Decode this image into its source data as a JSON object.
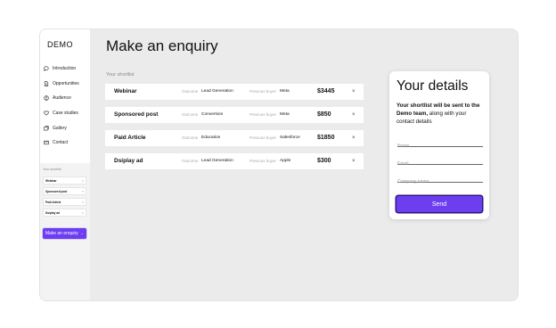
{
  "sidebar": {
    "logo": "DEMO",
    "items": [
      {
        "label": "Introduction",
        "icon": "chat-icon"
      },
      {
        "label": "Opportunities",
        "icon": "document-icon"
      },
      {
        "label": "Audience",
        "icon": "user-icon"
      },
      {
        "label": "Case studies",
        "icon": "heart-icon"
      },
      {
        "label": "Gallery",
        "icon": "gallery-icon"
      },
      {
        "label": "Contact",
        "icon": "mail-icon"
      }
    ],
    "shortlist": {
      "title": "Your shortlist",
      "items": [
        "Webinar",
        "Sponsored post",
        "Paid Article",
        "Dsiplay ad"
      ],
      "remove": "×"
    },
    "cta": "Make an enquiry →"
  },
  "main": {
    "title": "Make an enquiry",
    "shortlist_label": "Your shortlist",
    "outcome_label": "Outcome",
    "buyer_label": "Previous buyer",
    "remove": "×",
    "rows": [
      {
        "name": "Webinar",
        "outcome": "Lead Generation",
        "buyer": "Meta",
        "price": "$3445"
      },
      {
        "name": "Sponsored post",
        "outcome": "Conversion",
        "buyer": "Meta",
        "price": "$850"
      },
      {
        "name": "Paid Article",
        "outcome": "Education",
        "buyer": "Salesforce",
        "price": "$1850"
      },
      {
        "name": "Dsiplay ad",
        "outcome": "Lead Generation",
        "buyer": "Apple",
        "price": "$300"
      }
    ]
  },
  "details": {
    "title": "Your details",
    "desc_bold": "Your shortlist will be sent to the Demo team,",
    "desc_rest": " along with your contact details",
    "name_placeholder": "Name",
    "email_placeholder": "Email",
    "company_placeholder": "Company name",
    "send": "Send"
  },
  "colors": {
    "accent": "#6c3ef0"
  }
}
